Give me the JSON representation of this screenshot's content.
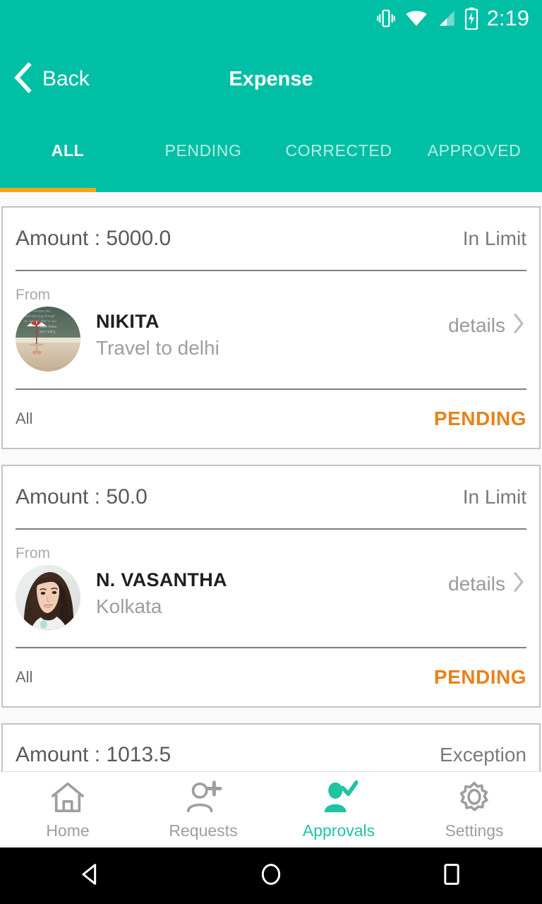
{
  "statusbar": {
    "time": "2:19",
    "icons": [
      "vibrate-icon",
      "wifi-icon",
      "cellular-signal-icon",
      "battery-charging-icon"
    ]
  },
  "appbar": {
    "back_label": "Back",
    "back_icon": "chevron-left-icon",
    "title": "Expense"
  },
  "tabs": {
    "items": [
      {
        "label": "ALL",
        "active": true
      },
      {
        "label": "PENDING",
        "active": false
      },
      {
        "label": "CORRECTED",
        "active": false
      },
      {
        "label": "APPROVED",
        "active": false
      }
    ],
    "indicator_color": "#f7a41d"
  },
  "colors": {
    "brand_teal": "#00bfa5",
    "accent_orange": "#e8821a",
    "tab_indicator": "#f7a41d",
    "active_nav": "#1fc4a1",
    "muted_text": "#9e9e9e"
  },
  "cards": [
    {
      "amount_label": "Amount : 5000.0",
      "limit_status": "In Limit",
      "from_label": "From",
      "person_name": "NIKITA",
      "person_sub": "Travel to delhi",
      "details_label": "details",
      "details_icon": "chevron-right-icon",
      "avatar": "beach-umbrella-photo",
      "footer_scope": "All",
      "footer_status": "PENDING"
    },
    {
      "amount_label": "Amount : 50.0",
      "limit_status": "In Limit",
      "from_label": "From",
      "person_name": "N. VASANTHA",
      "person_sub": "Kolkata",
      "details_label": "details",
      "details_icon": "chevron-right-icon",
      "avatar": "woman-portrait-photo",
      "footer_scope": "All",
      "footer_status": "PENDING"
    }
  ],
  "partial_card": {
    "amount_label": "Amount : 1013.5",
    "limit_status": "Exception"
  },
  "bottomnav": {
    "items": [
      {
        "label": "Home",
        "icon": "home-icon",
        "active": false
      },
      {
        "label": "Requests",
        "icon": "person-add-icon",
        "active": false
      },
      {
        "label": "Approvals",
        "icon": "person-check-icon",
        "active": true
      },
      {
        "label": "Settings",
        "icon": "gear-icon",
        "active": false
      }
    ]
  },
  "androidnav": {
    "items": [
      {
        "icon": "android-back-icon"
      },
      {
        "icon": "android-home-icon"
      },
      {
        "icon": "android-recents-icon"
      }
    ]
  }
}
